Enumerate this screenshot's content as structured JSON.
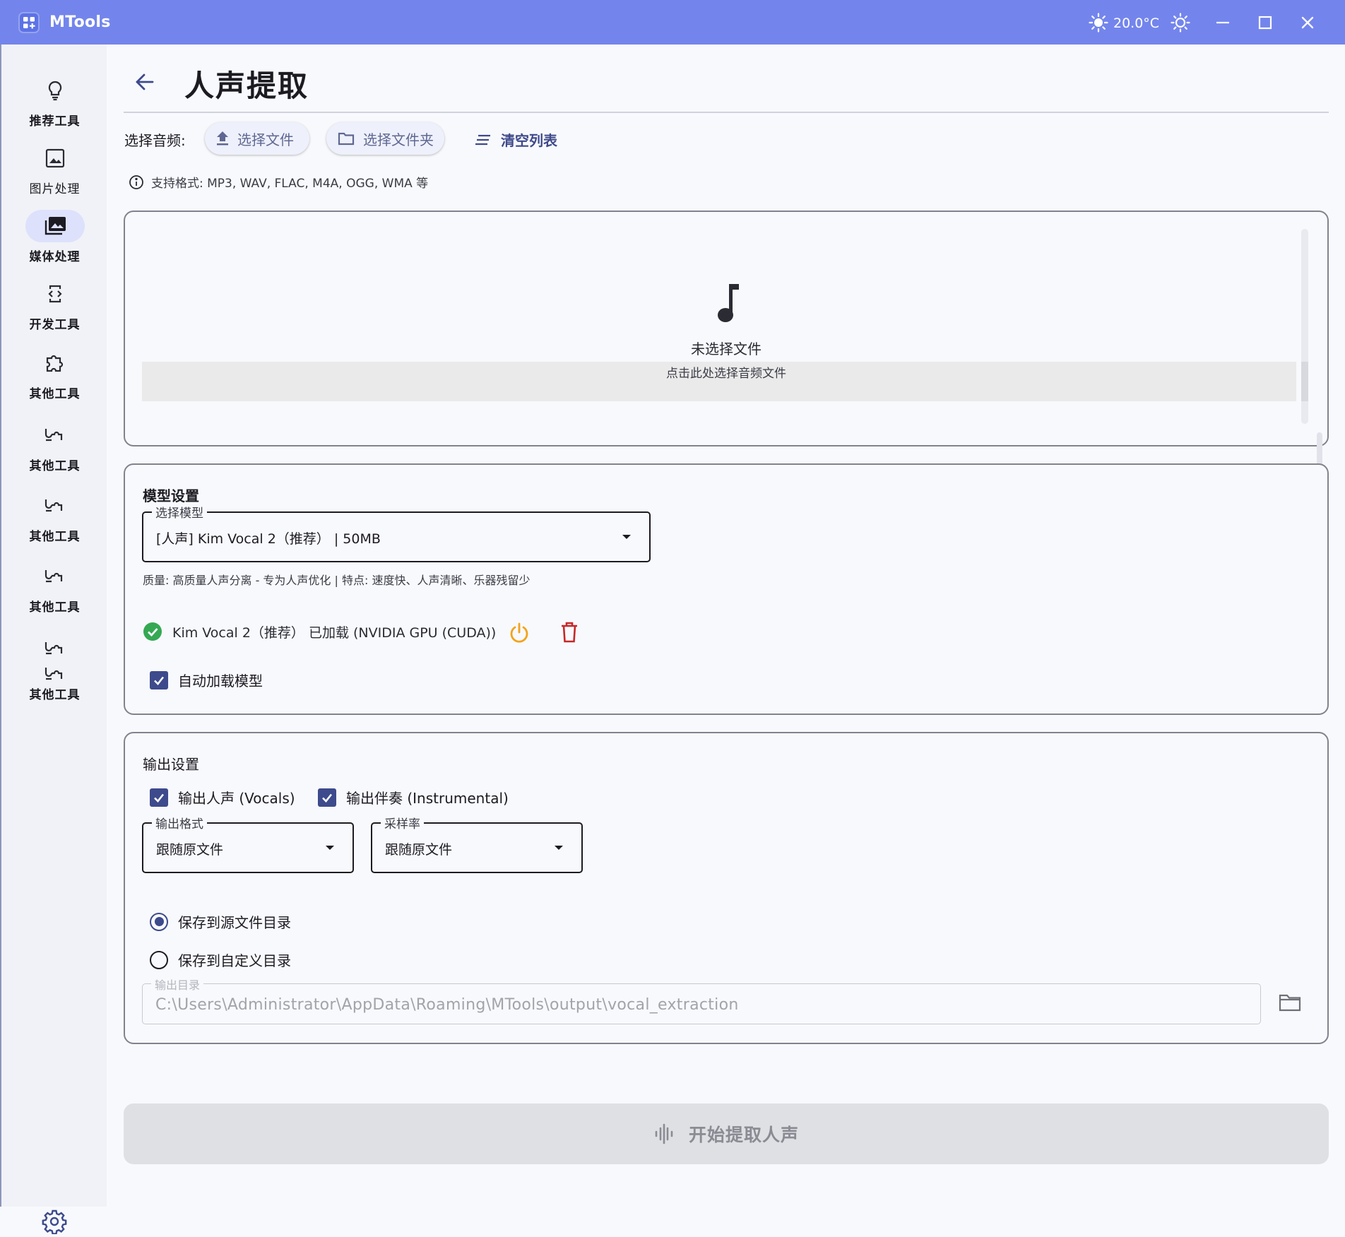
{
  "window": {
    "app_title": "MTools",
    "weather_temp": "20.0°C",
    "icons": {
      "logo": "apps-grid-icon",
      "weather": "sun-icon",
      "theme": "brightness-icon",
      "minimize": "minimize-icon",
      "maximize": "maximize-icon",
      "close": "close-icon"
    },
    "colors": {
      "titlebar": "#7385ec",
      "accent": "#3d4a8c",
      "success": "#34a853",
      "warning": "#f2a31b",
      "danger": "#c62828"
    }
  },
  "sidebar": {
    "items": [
      {
        "label": "推荐工具",
        "icon": "lightbulb-icon"
      },
      {
        "label": "图片处理",
        "icon": "image-icon"
      },
      {
        "label": "媒体处理",
        "icon": "photo-library-icon",
        "active": true
      },
      {
        "label": "开发工具",
        "icon": "developer-mode-icon"
      },
      {
        "label": "其他工具",
        "icon": "extension-icon"
      },
      {
        "label": "其他工具",
        "icon": "extension-icon"
      },
      {
        "label": "其他工具",
        "icon": "extension-icon"
      },
      {
        "label": "其他工具",
        "icon": "extension-icon"
      },
      {
        "label": "其他工具",
        "icon": "extension-icon"
      }
    ],
    "settings_icon": "gear-icon"
  },
  "page": {
    "title": "人声提取",
    "back_icon": "arrow-back-icon"
  },
  "toolbar": {
    "select_label": "选择音频:",
    "select_file": "选择文件",
    "select_folder": "选择文件夹",
    "clear_list": "清空列表"
  },
  "format_hint": "支持格式: MP3, WAV, FLAC, M4A, OGG, WMA 等",
  "dropzone": {
    "title": "未选择文件",
    "subtitle": "点击此处选择音频文件"
  },
  "model": {
    "section_title": "模型设置",
    "select_legend": "选择模型",
    "selected": "[人声] Kim Vocal 2（推荐） | 50MB",
    "description": "质量: 高质量人声分离 - 专为人声优化 | 特点: 速度快、人声清晰、乐器残留少",
    "loaded_status": "Kim Vocal 2（推荐） 已加载 (NVIDIA GPU (CUDA))",
    "auto_load_label": "自动加载模型",
    "auto_load_checked": true
  },
  "output": {
    "section_title": "输出设置",
    "vocals_label": "输出人声 (Vocals)",
    "vocals_checked": true,
    "instrumental_label": "输出伴奏 (Instrumental)",
    "instrumental_checked": true,
    "format_legend": "输出格式",
    "format_value": "跟随原文件",
    "samplerate_legend": "采样率",
    "samplerate_value": "跟随原文件",
    "save_source_label": "保存到源文件目录",
    "save_custom_label": "保存到自定义目录",
    "selected_option": "保存到源文件目录",
    "dir_legend": "输出目录",
    "dir_value": "C:\\Users\\Administrator\\AppData\\Roaming\\MTools\\output\\vocal_extraction"
  },
  "start_button": "开始提取人声"
}
